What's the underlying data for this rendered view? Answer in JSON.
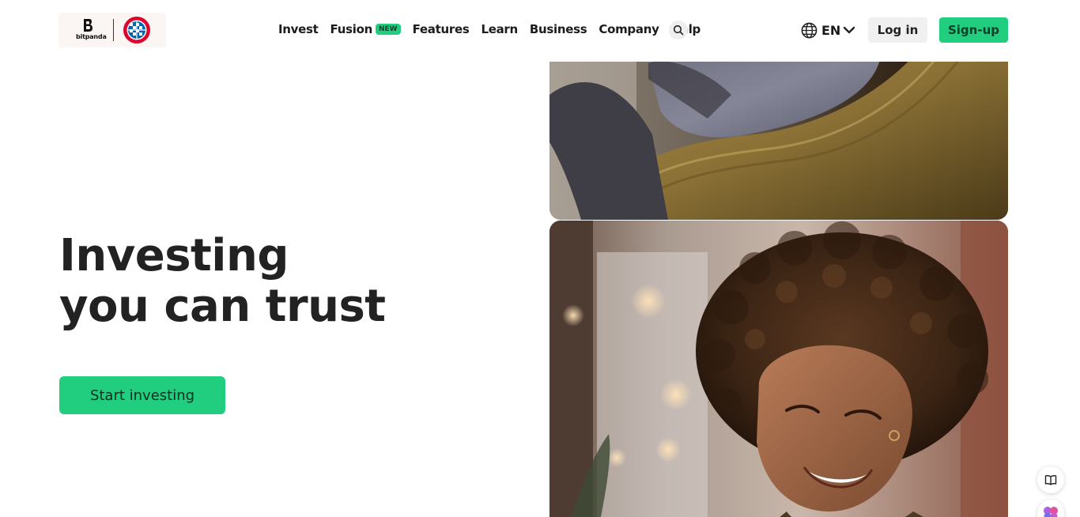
{
  "brand": {
    "name": "bitpanda",
    "partner_logo": "fc-bayern-crest"
  },
  "nav": {
    "items": [
      {
        "label": "Invest"
      },
      {
        "label": "Fusion",
        "badge": "NEW"
      },
      {
        "label": "Features"
      },
      {
        "label": "Learn"
      },
      {
        "label": "Business"
      },
      {
        "label": "Company"
      },
      {
        "label": "Help"
      }
    ],
    "search_icon": "search-icon"
  },
  "header_actions": {
    "language_icon": "globe-icon",
    "language": "EN",
    "login_label": "Log in",
    "signup_label": "Sign-up"
  },
  "hero": {
    "title_line1": "Investing",
    "title_line2": "you can trust",
    "cta_label": "Start investing"
  },
  "images": {
    "top": "person seated in woven chair",
    "bottom": "smiling woman with curly hair"
  },
  "widgets": [
    {
      "icon": "book-icon"
    },
    {
      "icon": "brain-icon"
    }
  ],
  "colors": {
    "accent": "#21ce7f",
    "text": "#222222",
    "login_bg": "#f0f0f0"
  }
}
